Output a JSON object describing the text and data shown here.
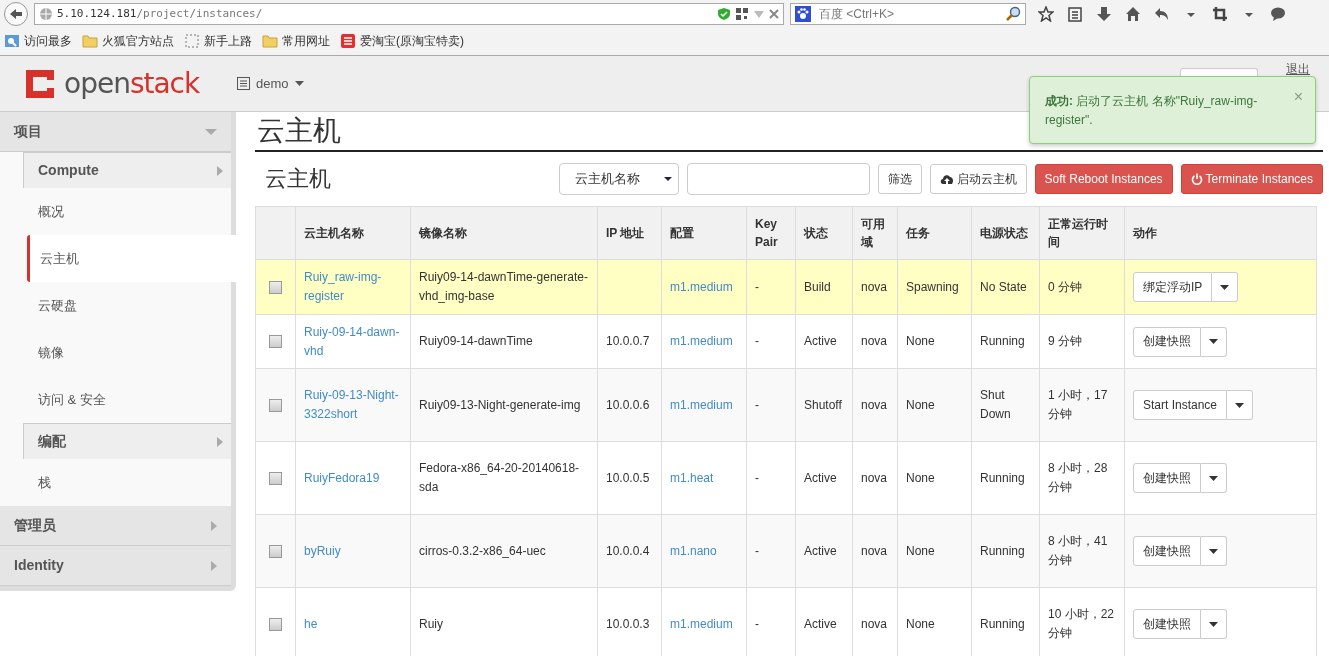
{
  "browser": {
    "url_host": "5.10.124.181",
    "url_path": "/project/instances/",
    "search_placeholder": "百度 <Ctrl+K>",
    "bookmarks": [
      {
        "label": "访问最多"
      },
      {
        "label": "火狐官方站点"
      },
      {
        "label": "新手上路"
      },
      {
        "label": "常用网址"
      },
      {
        "label": "爱淘宝(原淘宝特卖)"
      }
    ]
  },
  "header": {
    "logo_a": "open",
    "logo_b": "stack",
    "project": "demo",
    "logout": "退出"
  },
  "toast": {
    "title": "成功:",
    "message": "启动了云主机 名称\"Ruiy_raw-img-register\".",
    "close": "×"
  },
  "sidebar": [
    {
      "label": "项目",
      "kind": "dashboard",
      "expanded": true,
      "children": [
        {
          "label": "Compute",
          "kind": "panel",
          "children": [
            {
              "label": "概况",
              "selected": false
            },
            {
              "label": "云主机",
              "selected": true
            },
            {
              "label": "云硬盘",
              "selected": false
            },
            {
              "label": "镜像",
              "selected": false
            },
            {
              "label": "访问 & 安全",
              "selected": false
            }
          ]
        },
        {
          "label": "编配",
          "kind": "panel",
          "children": [
            {
              "label": "栈",
              "selected": false
            }
          ]
        }
      ]
    },
    {
      "label": "管理员",
      "kind": "dashboard",
      "expanded": false
    },
    {
      "label": "Identity",
      "kind": "dashboard",
      "expanded": false
    }
  ],
  "page_title": "云主机",
  "table": {
    "title": "云主机",
    "filter_select": "云主机名称",
    "filter_button": "筛选",
    "launch_button": "启动云主机",
    "soft_reboot_button": "Soft Reboot Instances",
    "terminate_button": "Terminate Instances",
    "columns": [
      "云主机名称",
      "镜像名称",
      "IP 地址",
      "配置",
      "Key Pair",
      "状态",
      "可用域",
      "任务",
      "电源状态",
      "正常运行时间",
      "动作"
    ],
    "rows": [
      {
        "highlighted": true,
        "checked": false,
        "name": "Ruiy_raw-img-register",
        "image": "Ruiy09-14-dawnTime-generate-vhd_img-base",
        "ip": "",
        "flavor": "m1.medium",
        "key_pair": "-",
        "status": "Build",
        "zone": "nova",
        "task": "Spawning",
        "power": "No State",
        "uptime": "0 分钟",
        "action": "绑定浮动IP"
      },
      {
        "highlighted": false,
        "checked": false,
        "name": "Ruiy-09-14-dawn-vhd",
        "image": "Ruiy09-14-dawnTime",
        "ip": "10.0.0.7",
        "flavor": "m1.medium",
        "key_pair": "-",
        "status": "Active",
        "zone": "nova",
        "task": "None",
        "power": "Running",
        "uptime": "9 分钟",
        "action": "创建快照"
      },
      {
        "highlighted": false,
        "checked": false,
        "name": "Ruiy-09-13-Night-3322short",
        "image": "Ruiy09-13-Night-generate-img",
        "ip": "10.0.0.6",
        "flavor": "m1.medium",
        "key_pair": "-",
        "status": "Shutoff",
        "zone": "nova",
        "task": "None",
        "power": "Shut Down",
        "uptime": "1 小时，17 分钟",
        "action": "Start Instance"
      },
      {
        "highlighted": false,
        "checked": false,
        "name": "RuiyFedora19",
        "image": "Fedora-x86_64-20-20140618-sda",
        "ip": "10.0.0.5",
        "flavor": "m1.heat",
        "key_pair": "-",
        "status": "Active",
        "zone": "nova",
        "task": "None",
        "power": "Running",
        "uptime": "8 小时，28 分钟",
        "action": "创建快照"
      },
      {
        "highlighted": false,
        "checked": false,
        "name": "byRuiy",
        "image": "cirros-0.3.2-x86_64-uec",
        "ip": "10.0.0.4",
        "flavor": "m1.nano",
        "key_pair": "-",
        "status": "Active",
        "zone": "nova",
        "task": "None",
        "power": "Running",
        "uptime": "8 小时，41 分钟",
        "action": "创建快照"
      },
      {
        "highlighted": false,
        "checked": false,
        "name": "he",
        "image": "Ruiy",
        "ip": "10.0.0.3",
        "flavor": "m1.medium",
        "key_pair": "-",
        "status": "Active",
        "zone": "nova",
        "task": "None",
        "power": "Running",
        "uptime": "10 小时，22 分钟",
        "action": "创建快照"
      }
    ]
  }
}
